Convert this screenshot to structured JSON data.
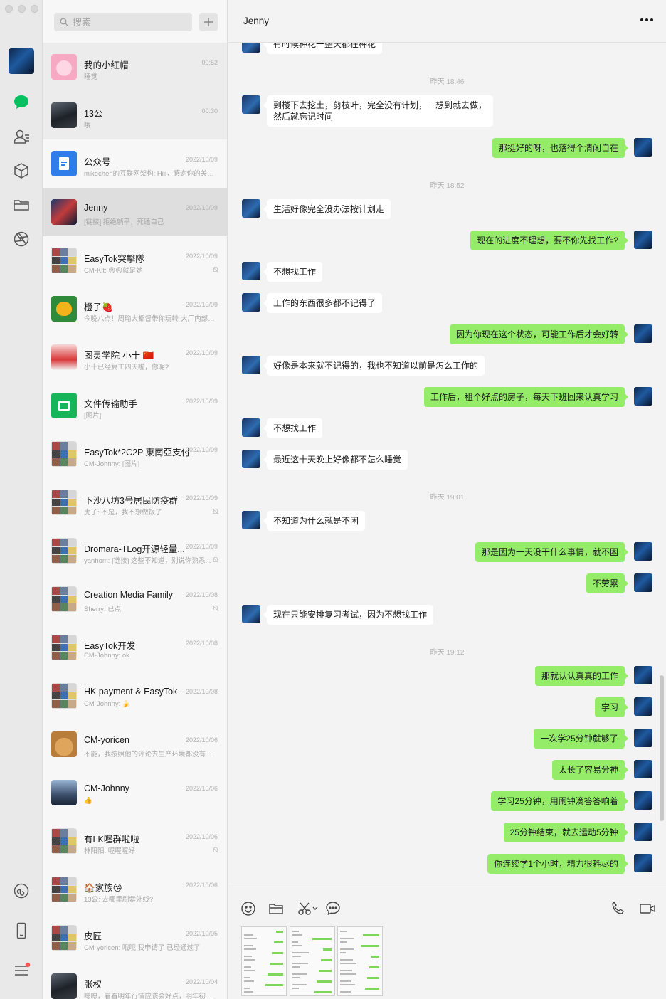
{
  "search": {
    "placeholder": "搜索"
  },
  "chat": {
    "title": "Jenny",
    "messages": [
      {
        "side": "in",
        "text": "有时候种花一整天都在种花"
      },
      {
        "type": "time",
        "text": "昨天 18:46"
      },
      {
        "side": "in",
        "text": "到楼下去挖土，剪枝叶，完全没有计划，一想到就去做，然后就忘记时间"
      },
      {
        "side": "out",
        "text": "那挺好的呀，也落得个清闲自在"
      },
      {
        "type": "time",
        "text": "昨天 18:52"
      },
      {
        "side": "in",
        "text": "生活好像完全没办法按计划走"
      },
      {
        "side": "out",
        "text": "现在的进度不理想，要不你先找工作?"
      },
      {
        "side": "in",
        "text": "不想找工作"
      },
      {
        "side": "in",
        "text": "工作的东西很多都不记得了"
      },
      {
        "side": "out",
        "text": "因为你现在这个状态，可能工作后才会好转"
      },
      {
        "side": "in",
        "text": "好像是本来就不记得的，我也不知道以前是怎么工作的"
      },
      {
        "side": "out",
        "text": "工作后，租个好点的房子，每天下班回来认真学习"
      },
      {
        "side": "in",
        "text": "不想找工作"
      },
      {
        "side": "in",
        "text": "最近这十天晚上好像都不怎么睡觉"
      },
      {
        "type": "time",
        "text": "昨天 19:01"
      },
      {
        "side": "in",
        "text": "不知道为什么就是不困"
      },
      {
        "side": "out",
        "text": "那是因为一天没干什么事情，就不困"
      },
      {
        "side": "out",
        "text": "不劳累"
      },
      {
        "side": "in",
        "text": "现在只能安排复习考试，因为不想找工作"
      },
      {
        "type": "time",
        "text": "昨天 19:12"
      },
      {
        "side": "out",
        "text": "那就认认真真的工作"
      },
      {
        "side": "out",
        "text": "学习"
      },
      {
        "side": "out",
        "text": "一次学25分钟就够了"
      },
      {
        "side": "out",
        "text": "太长了容易分神"
      },
      {
        "side": "out",
        "text": "学习25分钟，用闹钟滴答答响着"
      },
      {
        "side": "out",
        "text": "25分钟结束，就去运动5分钟"
      },
      {
        "side": "out",
        "text": "你连续学1个小时，精力很耗尽的"
      }
    ]
  },
  "conversations": [
    {
      "name": "我的小红帽",
      "time": "00:52",
      "preview": "睡觉",
      "pinned": true,
      "muted": false,
      "avatar": "pink"
    },
    {
      "name": "13公",
      "time": "00:30",
      "preview": "哦",
      "pinned": true,
      "muted": false,
      "avatar": "photo-dark"
    },
    {
      "name": "公众号",
      "time": "2022/10/09",
      "preview": "mikechen的互联网架构: Hiii，感谢你的关注...",
      "pinned": false,
      "muted": false,
      "avatar": "blue-doc"
    },
    {
      "name": "Jenny",
      "time": "2022/10/09",
      "preview": "[链接] 拒绝躺平，死磕自己",
      "pinned": false,
      "muted": false,
      "selected": true,
      "avatar": "photo-jenny"
    },
    {
      "name": "EasyTok突擊隊",
      "time": "2022/10/09",
      "preview": "CM-Kit: 😠😠就是她",
      "pinned": false,
      "muted": true,
      "avatar": "group"
    },
    {
      "name": "橙子🍓",
      "time": "2022/10/09",
      "preview": "今晚八点！周瑜大都督带你玩转-大厂内部自...",
      "pinned": false,
      "muted": false,
      "avatar": "cat"
    },
    {
      "name": "图灵学院-小十 🇨🇳",
      "time": "2022/10/09",
      "preview": "小十已经复工四天啦，你呢?",
      "pinned": false,
      "muted": false,
      "avatar": "red-poster"
    },
    {
      "name": "文件传输助手",
      "time": "2022/10/09",
      "preview": "[图片]",
      "pinned": false,
      "muted": false,
      "avatar": "green-file"
    },
    {
      "name": "EasyTok*2C2P 東南亞支付",
      "time": "2022/10/09",
      "preview": "CM-Johnny: [图片]",
      "pinned": false,
      "muted": false,
      "avatar": "group"
    },
    {
      "name": "下沙八坊3号居民防疫群",
      "time": "2022/10/09",
      "preview": "虎子: 不是，我不想做饭了",
      "pinned": false,
      "muted": true,
      "avatar": "group"
    },
    {
      "name": "Dromara-TLog开源轻量...",
      "time": "2022/10/09",
      "preview": "yanhom: [链接] 这些不知道，别说你熟悉...",
      "pinned": false,
      "muted": true,
      "avatar": "group"
    },
    {
      "name": "Creation Media Family",
      "time": "2022/10/08",
      "preview": "Sherry: 已点",
      "pinned": false,
      "muted": true,
      "avatar": "group"
    },
    {
      "name": "EasyTok开发",
      "time": "2022/10/08",
      "preview": "CM-Johnny: ok",
      "pinned": false,
      "muted": false,
      "avatar": "group"
    },
    {
      "name": "HK payment & EasyTok",
      "time": "2022/10/08",
      "preview": "CM-Johnny: 🍌",
      "pinned": false,
      "muted": false,
      "avatar": "group"
    },
    {
      "name": "CM-yoricen",
      "time": "2022/10/06",
      "preview": "不能，我按照他的评论去生产环境都没有这...",
      "pinned": false,
      "muted": false,
      "avatar": "hamster"
    },
    {
      "name": "CM-Johnny",
      "time": "2022/10/06",
      "preview": "👍",
      "pinned": false,
      "muted": false,
      "avatar": "photo-blue"
    },
    {
      "name": "有LK喔群啦啦",
      "time": "2022/10/06",
      "preview": "林阳阳: 喔喔喔好",
      "pinned": false,
      "muted": true,
      "avatar": "group"
    },
    {
      "name": "🏠家族😘",
      "time": "2022/10/06",
      "preview": "13公: 去哪里刷紫外线?",
      "pinned": false,
      "muted": false,
      "avatar": "group"
    },
    {
      "name": "皮匠",
      "time": "2022/10/05",
      "preview": "CM-yoricen: 哦哦 我申请了 已经通过了",
      "pinned": false,
      "muted": false,
      "avatar": "group"
    },
    {
      "name": "张权",
      "time": "2022/10/04",
      "preview": "嗯嗯，看看明年行情应该会好点，明年初应...",
      "pinned": false,
      "muted": false,
      "avatar": "photo-dark"
    }
  ],
  "colors": {
    "accent": "#07c160",
    "bubble_out": "#95ec69",
    "bubble_in": "#ffffff",
    "rail_bg": "#e9e9e9",
    "list_bg": "#f7f7f7",
    "badge": "#fa5151"
  },
  "rail_icons": [
    "chat-icon",
    "contacts-icon",
    "favorites-box-icon",
    "folder-icon",
    "moments-shutter-icon",
    "mini-program-icon",
    "phone-icon",
    "menu-icon"
  ],
  "composer_icons": [
    "emoji-icon",
    "folder-icon",
    "scissors-icon",
    "chat-history-icon",
    "voice-call-icon",
    "video-call-icon"
  ]
}
